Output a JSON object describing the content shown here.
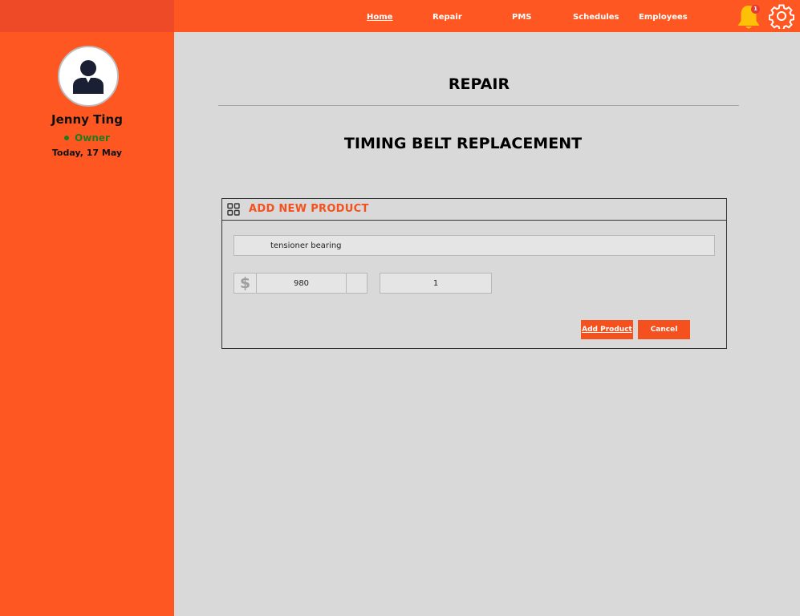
{
  "nav": {
    "items": [
      {
        "label": "Home",
        "active": true
      },
      {
        "label": "Repair",
        "active": false
      },
      {
        "label": "PMS",
        "active": false
      },
      {
        "label": "Schedules",
        "active": false
      },
      {
        "label": "Employees",
        "active": false
      }
    ],
    "notification_count": "1",
    "icons": {
      "notifications": "bell-icon",
      "settings": "gear-icon"
    }
  },
  "user": {
    "name": "Jenny Ting",
    "role": "Owner",
    "date": "Today, 17 May"
  },
  "page": {
    "title": "REPAIR",
    "repair_name": "TIMING BELT REPLACEMENT"
  },
  "panel": {
    "title": "ADD NEW PRODUCT",
    "product_name": "tensioner bearing",
    "currency_symbol": "$",
    "price": "980",
    "quantity": "1",
    "add_label": "Add Product",
    "cancel_label": "Cancel"
  },
  "colors": {
    "brand_orange": "#ff5722",
    "accent_dark_orange": "#f4511e",
    "status_green": "#1e7b1e",
    "bell_yellow": "#ffc107",
    "background_gray": "#d9d9d9"
  }
}
